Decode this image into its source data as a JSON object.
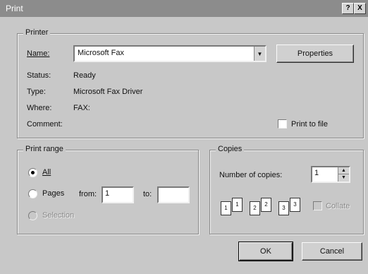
{
  "window": {
    "title": "Print",
    "help_glyph": "?",
    "close_glyph": "X"
  },
  "printer": {
    "group_label": "Printer",
    "name_label": "Name:",
    "name_value": "Microsoft Fax",
    "properties_label": "Properties",
    "status_label": "Status:",
    "status_value": "Ready",
    "type_label": "Type:",
    "type_value": "Microsoft Fax Driver",
    "where_label": "Where:",
    "where_value": "FAX:",
    "comment_label": "Comment:",
    "print_to_file_label": "Print to file",
    "print_to_file_checked": false
  },
  "print_range": {
    "group_label": "Print range",
    "all_label": "All",
    "pages_label": "Pages",
    "from_label": "from:",
    "from_value": "1",
    "to_label": "to:",
    "to_value": "",
    "selection_label": "Selection",
    "selected": "all"
  },
  "copies": {
    "group_label": "Copies",
    "number_label": "Number of copies:",
    "number_value": "1",
    "collate_label": "Collate",
    "collate_checked": false
  },
  "buttons": {
    "ok_label": "OK",
    "cancel_label": "Cancel"
  }
}
